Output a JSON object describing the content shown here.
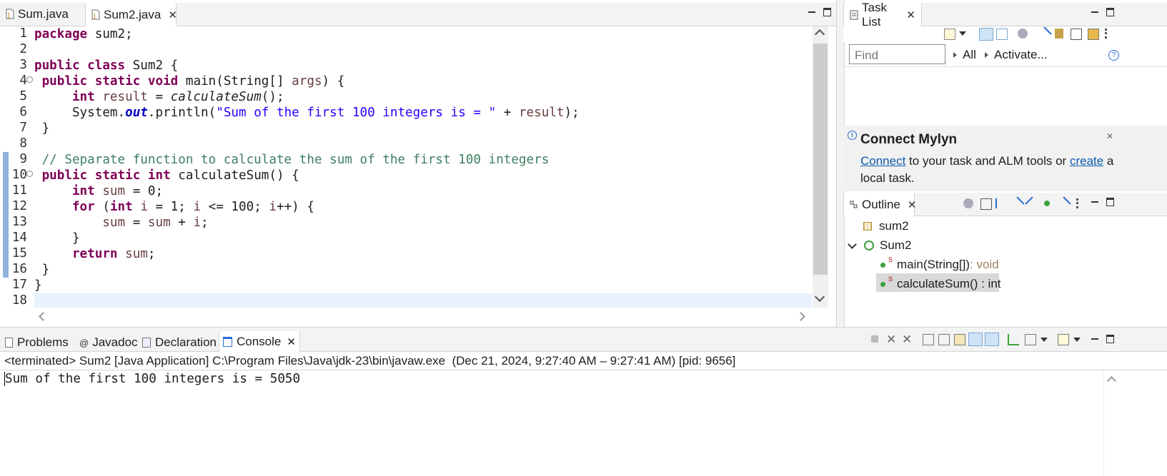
{
  "editor": {
    "tabs": [
      {
        "label": "Sum.java",
        "active": false
      },
      {
        "label": "Sum2.java",
        "active": true
      }
    ],
    "close_glyph": "✕",
    "line_numbers": [
      "1",
      "2",
      "3",
      "4",
      "5",
      "6",
      "7",
      "8",
      "9",
      "10",
      "11",
      "12",
      "13",
      "14",
      "15",
      "16",
      "17",
      "18"
    ],
    "code": {
      "l1_kw": "package",
      "l1_rest": " sum2;",
      "l3_kw1": "public",
      "l3_kw2": "class",
      "l3_rest": " Sum2 {",
      "l4_kw1": "public",
      "l4_kw2": "static",
      "l4_kw3": "void",
      "l4_mid": " main(String[] ",
      "l4_var": "args",
      "l4_end": ") {",
      "l5_kw": "int",
      "l5_var": "result",
      "l5_eq": " = ",
      "l5_call": "calculateSum",
      "l5_end": "();",
      "l6_a": "System.",
      "l6_field": "out",
      "l6_b": ".println(",
      "l6_str": "\"Sum of the first 100 integers is = \"",
      "l6_c": " + ",
      "l6_var": "result",
      "l6_end": ");",
      "l7": "}",
      "l9_comment": "// Separate function to calculate the sum of the first 100 integers",
      "l10_kw1": "public",
      "l10_kw2": "static",
      "l10_kw3": "int",
      "l10_rest": " calculateSum() {",
      "l11_kw": "int",
      "l11_var": "sum",
      "l11_rest": " = 0;",
      "l12_kw1": "for",
      "l12_kw2": "int",
      "l12_a": " (",
      "l12_i1": "i",
      "l12_b": " = 1; ",
      "l12_i2": "i",
      "l12_c": " <= 100; ",
      "l12_i3": "i",
      "l12_d": "++) {",
      "l13_v1": "sum",
      "l13_eq": " = ",
      "l13_v2": "sum",
      "l13_plus": " + ",
      "l13_v3": "i",
      "l13_end": ";",
      "l14": "}",
      "l15_kw": "return",
      "l15_var": "sum",
      "l15_end": ";",
      "l16": "}",
      "l17": "}"
    }
  },
  "task_list": {
    "title": "Task List",
    "find_placeholder": "Find",
    "filter_all": "All",
    "activate": "Activate...",
    "help_glyph": "?"
  },
  "mylyn": {
    "title": "Connect Mylyn",
    "connect_link": "Connect",
    "text_mid": " to your task and ALM tools or ",
    "create_link": "create",
    "text_end": " a local task."
  },
  "outline": {
    "title": "Outline",
    "items": [
      {
        "label": "sum2"
      },
      {
        "label": "Sum2"
      },
      {
        "label": "main(String[])",
        "ret": " : void"
      },
      {
        "label": "calculateSum() : int"
      }
    ]
  },
  "console": {
    "tabs": [
      "Problems",
      "Javadoc",
      "Declaration",
      "Console"
    ],
    "status": "<terminated> Sum2 [Java Application] C:\\Program Files\\Java\\jdk-23\\bin\\javaw.exe  (Dec 21, 2024, 9:27:40 AM – 9:27:41 AM) [pid: 9656]",
    "output": "Sum of the first 100 integers is = 5050"
  },
  "colors": {
    "keyword": "#7f0055",
    "string": "#2a00ff",
    "comment": "#3f7f5f",
    "local_var": "#6a3e3e",
    "field": "#0000c0",
    "link": "#0b5cad"
  }
}
